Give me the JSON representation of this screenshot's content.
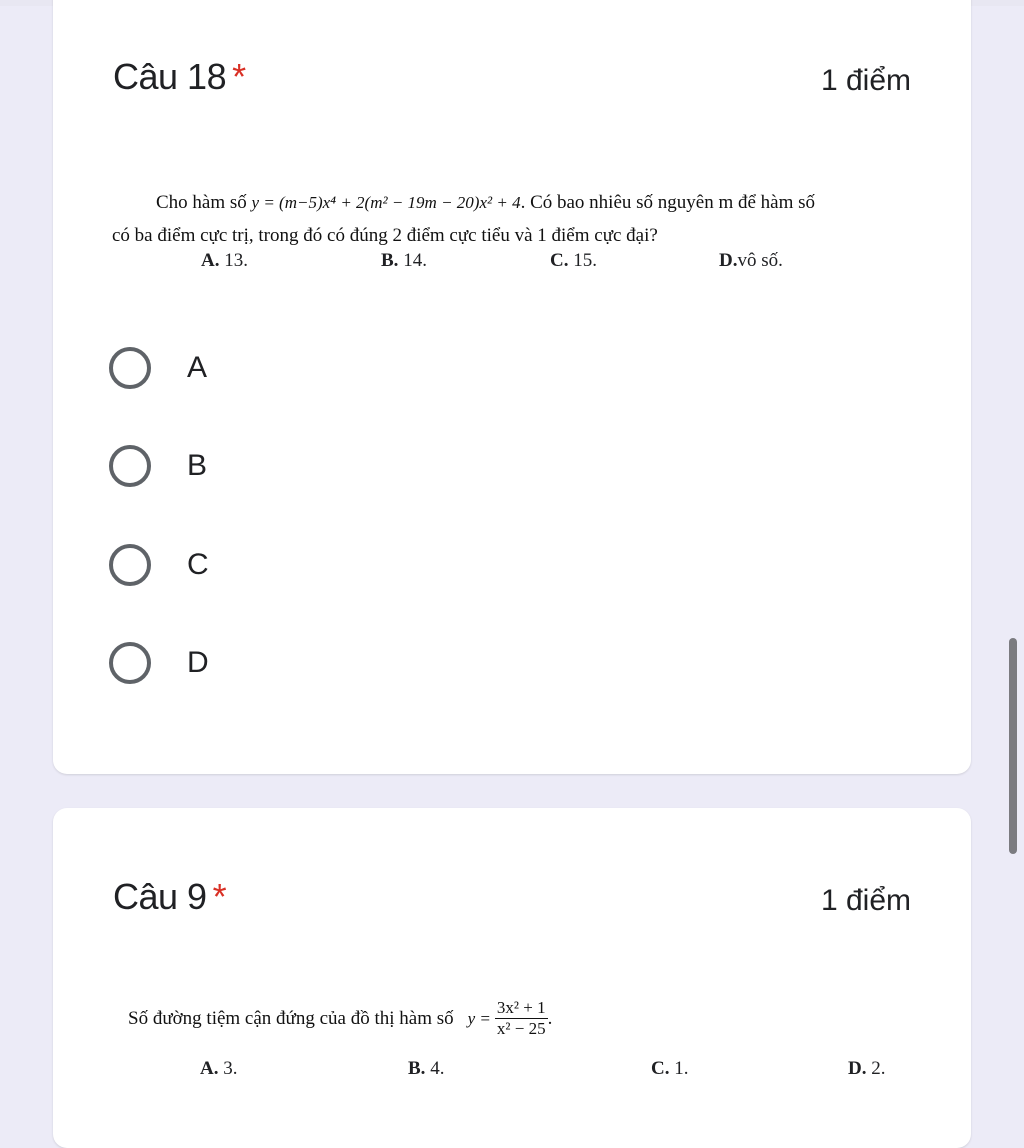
{
  "q1": {
    "title": "Câu 18",
    "required_mark": "*",
    "points": "1 điểm",
    "text_prefix": "Cho hàm số",
    "formula": "y = (m−5)x⁴ + 2(m² − 19m − 20)x² + 4",
    "text_suffix": ". Có bao nhiêu số nguyên m để hàm số",
    "text_line2": "có ba điểm cực trị, trong đó có đúng 2 điểm cực tiểu và 1 điểm cực đại?",
    "answers": [
      {
        "key": "A.",
        "value": "13."
      },
      {
        "key": "B.",
        "value": "14."
      },
      {
        "key": "C.",
        "value": "15."
      },
      {
        "key": "D.",
        "value": "vô số."
      }
    ],
    "options": [
      "A",
      "B",
      "C",
      "D"
    ]
  },
  "q2": {
    "title": "Câu 9",
    "required_mark": "*",
    "points": "1 điểm",
    "text": "Số đường tiệm cận đứng của đồ thị hàm số",
    "formula_lhs": "y =",
    "formula_num": "3x² + 1",
    "formula_den": "x² − 25",
    "formula_end": ".",
    "answers": [
      {
        "key": "A.",
        "value": "3."
      },
      {
        "key": "B.",
        "value": "4."
      },
      {
        "key": "C.",
        "value": "1."
      },
      {
        "key": "D.",
        "value": "2."
      }
    ]
  }
}
